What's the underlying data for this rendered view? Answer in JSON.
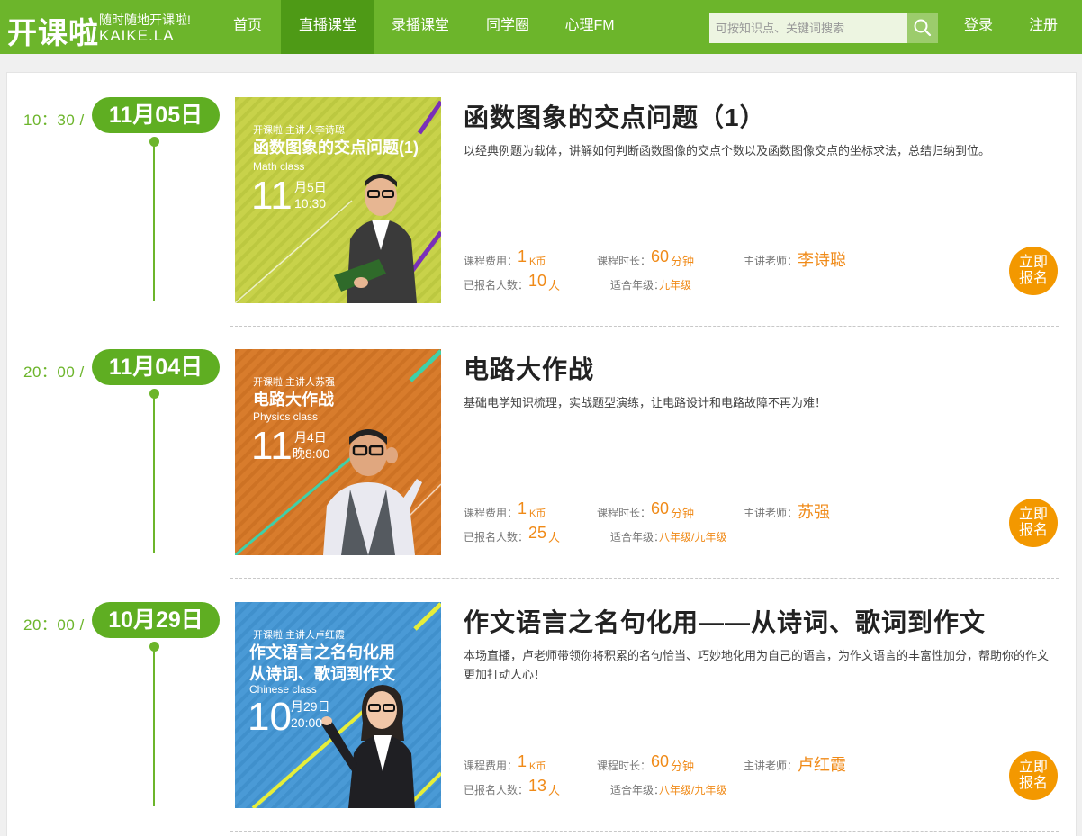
{
  "header": {
    "logo_text": "开课啦",
    "logo_slogan": "随时随地开课啦!",
    "logo_domain": "KAIKE.LA",
    "nav": [
      "首页",
      "直播课堂",
      "录播课堂",
      "同学圈",
      "心理FM"
    ],
    "active_nav": "直播课堂",
    "search_placeholder": "可按知识点、关键词搜索",
    "login": "登录",
    "register": "注册",
    "brand_color": "#6cb52b"
  },
  "labels": {
    "fee": "课程费用：",
    "duration": "课程时长：",
    "teacher": "主讲老师：",
    "enrolled": "已报名人数：",
    "grade": "适合年级：",
    "signup_line1": "立即",
    "signup_line2": "报名"
  },
  "courses": [
    {
      "time": "10：30 /",
      "date": "11月05日",
      "title": "函数图象的交点问题（1）",
      "description": "以经典例题为载体，讲解如何判断函数图像的交点个数以及函数图像交点的坐标求法，总结归纳到位。",
      "fee_value": "1",
      "fee_unit": "K币",
      "duration_value": "60",
      "duration_unit": "分钟",
      "teacher": "李诗聪",
      "enrolled_value": "10",
      "enrolled_unit": "人",
      "grade": "九年级",
      "thumb": {
        "brand": "开课啦   主讲人李诗聪",
        "title_line1": "函数图象的交点问题(1)",
        "title_line2": "",
        "subject": "Math class",
        "month": "11",
        "date_line1": "月5日",
        "date_line2": "10:30",
        "bg_color": "#c8d24a"
      }
    },
    {
      "time": "20：00 /",
      "date": "11月04日",
      "title": "电路大作战",
      "description": "基础电学知识梳理，实战题型演练，让电路设计和电路故障不再为难！",
      "fee_value": "1",
      "fee_unit": "K币",
      "duration_value": "60",
      "duration_unit": "分钟",
      "teacher": "苏强",
      "enrolled_value": "25",
      "enrolled_unit": "人",
      "grade": "八年级/九年级",
      "thumb": {
        "brand": "开课啦   主讲人苏强",
        "title_line1": "电路大作战",
        "title_line2": "",
        "subject": "Physics class",
        "month": "11",
        "date_line1": "月4日",
        "date_line2": "晚8:00",
        "bg_color": "#d87c2c"
      }
    },
    {
      "time": "20：00 /",
      "date": "10月29日",
      "title": "作文语言之名句化用——从诗词、歌词到作文",
      "description": "本场直播，卢老师带领你将积累的名句恰当、巧妙地化用为自己的语言，为作文语言的丰富性加分，帮助你的作文更加打动人心！",
      "fee_value": "1",
      "fee_unit": "K币",
      "duration_value": "60",
      "duration_unit": "分钟",
      "teacher": "卢红霞",
      "enrolled_value": "13",
      "enrolled_unit": "人",
      "grade": "八年级/九年级",
      "thumb": {
        "brand": "开课啦   主讲人卢红霞",
        "title_line1": "作文语言之名句化用",
        "title_line2": "从诗词、歌词到作文",
        "subject": "Chinese class",
        "month": "10",
        "date_line1": "月29日",
        "date_line2": "20:00",
        "bg_color": "#4a9ad6"
      }
    }
  ]
}
